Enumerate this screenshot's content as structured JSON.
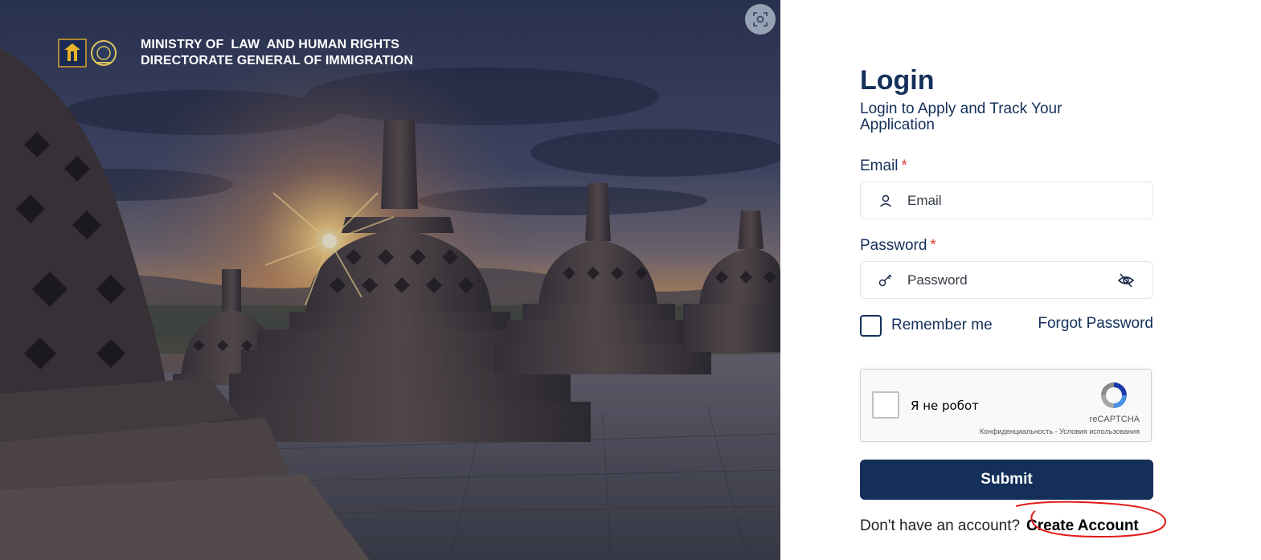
{
  "hero": {
    "org_line1": "MINISTRY OF  LAW  AND HUMAN RIGHTS",
    "org_line2": "DIRECTORATE GENERAL OF IMMIGRATION"
  },
  "login": {
    "title": "Login",
    "subtitle": "Login to Apply and Track Your Application",
    "email_label": "Email",
    "email_placeholder": "Email",
    "password_label": "Password",
    "password_placeholder": "Password",
    "required_mark": "*",
    "remember_label": "Remember me",
    "forgot_label": "Forgot Password",
    "submit_label": "Submit",
    "signup_prompt": "Don't have an account?",
    "signup_link": "Create Account"
  },
  "captcha": {
    "label": "Я не робот",
    "brand": "reCAPTCHA",
    "terms": "Конфиденциальность - Условия использования"
  },
  "colors": {
    "primary": "#14305a",
    "required": "#e03a3a",
    "annotation": "#e01b1b"
  }
}
